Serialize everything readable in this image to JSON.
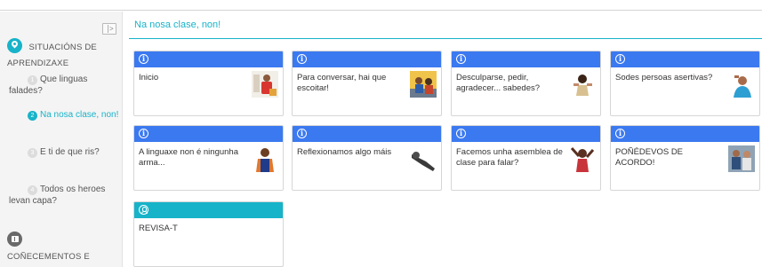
{
  "sidebar": {
    "sections": [
      {
        "title": "SITUACIÓNS DE APRENDIZAXE",
        "icon": "map-pin-icon"
      },
      {
        "title": "COÑECEMENTOS E",
        "icon": "book-icon"
      }
    ],
    "items": [
      {
        "num": "1",
        "label": "Que linguas falades?"
      },
      {
        "num": "2",
        "label": "Na nosa clase, non!"
      },
      {
        "num": "3",
        "label": "E ti de que ris?"
      },
      {
        "num": "4",
        "label": "Todos os heroes levan capa?"
      }
    ]
  },
  "main": {
    "title": "Na nosa clase, non!",
    "cards": [
      {
        "label": "Inicio",
        "icon": "info-icon"
      },
      {
        "label": "Para conversar, hai que escoitar!",
        "icon": "info-icon"
      },
      {
        "label": "Desculparse, pedir, agradecer... sabedes?",
        "icon": "info-icon"
      },
      {
        "label": "Sodes persoas asertivas?",
        "icon": "info-icon"
      },
      {
        "label": "A linguaxe non é ningunha arma...",
        "icon": "info-icon"
      },
      {
        "label": "Reflexionamos algo máis",
        "icon": "info-icon"
      },
      {
        "label": "Facemos unha asemblea de clase para falar?",
        "icon": "info-icon"
      },
      {
        "label": "POÑÉDEVOS DE ACORDO!",
        "icon": "info-icon"
      },
      {
        "label": "REVISA-T",
        "icon": "user-circle-icon"
      }
    ]
  },
  "colors": {
    "accent": "#17b3c9",
    "card_header": "#3b79f0",
    "sidebar_bg": "#f4f4f4"
  }
}
